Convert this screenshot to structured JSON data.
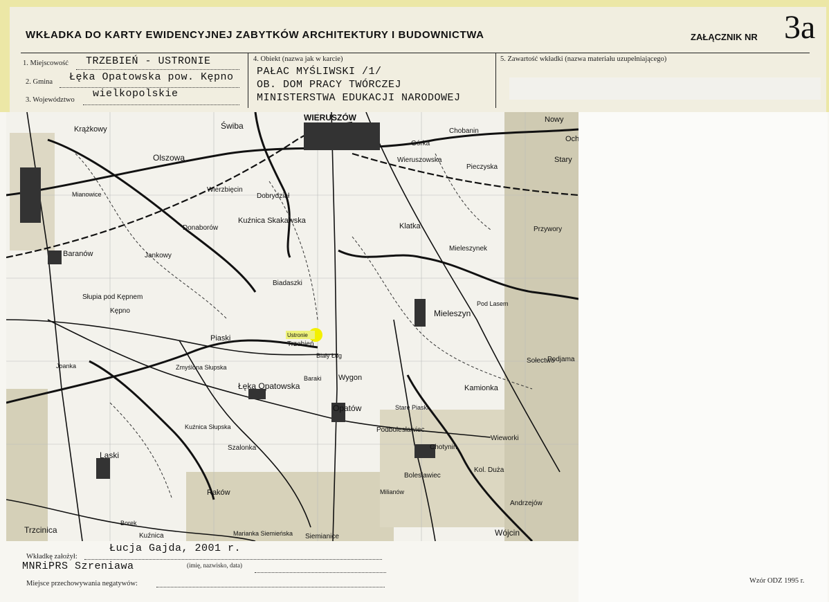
{
  "header": {
    "title": "WKŁADKA DO KARTY EWIDENCYJNEJ ZABYTKÓW ARCHITEKTURY I BUDOWNICTWA",
    "attachment_label": "ZAŁĄCZNIK NR",
    "attachment_number": "3a"
  },
  "fields": {
    "f1_label": "1. Miejscowość",
    "f1_value": "TRZEBIEŃ - USTRONIE",
    "f1_sub": "Łęka Opatowska  pow. Kępno",
    "f2_label": "2. Gmina",
    "f3_label": "3. Województwo",
    "f3_value": "wielkopolskie",
    "f4_label": "4. Obiekt (nazwa jak w karcie)",
    "f4_line1": "PAŁAC MYŚLIWSKI  /1/",
    "f4_line2": "OB. DOM PRACY TWÓRCZEJ",
    "f4_line3": "MINISTERSTWA EDUKACJI NARODOWEJ",
    "f5_label": "5. Zawartość wkładki (nazwa materiału uzupełniającego)"
  },
  "map": {
    "places": [
      "Krążkowy",
      "Świba",
      "WIERUSZÓW",
      "Chobanin",
      "Nowy",
      "Oche",
      "Olszowa",
      "Wieruszowska",
      "Górka",
      "Pieczyska",
      "Stary",
      "Mianowice",
      "Wierzbięcin",
      "Dobrydział",
      "Kuźnica Skakawska",
      "Klatka",
      "Przywory",
      "Donaborów",
      "Baranów",
      "Mieleszynek",
      "Jankowy",
      "Biadaszki",
      "Słupia pod Kępnem",
      "Mieleszyn",
      "Ustronie",
      "Trzebień",
      "Piaski",
      "Sołectwo",
      "Podjama",
      "Joanka",
      "Zmyślona Słupska",
      "Łęka Opatowska",
      "Wygon",
      "Opatów",
      "Kamionka",
      "Kuźnica Słupska",
      "Szalonka",
      "Podbolesławiec",
      "Chotynin",
      "Wieworki",
      "Laski",
      "Raków",
      "Kol. Duża",
      "Bolesławiec",
      "Andrzejów",
      "Trzcinica",
      "Borek",
      "Kuźnica",
      "Marianka Siemieńska",
      "Siemianice",
      "Wójcin",
      "Milianów",
      "Baraki",
      "Stare Piaski",
      "Pod Lasem",
      "Biały Ług",
      "Kępno"
    ],
    "highlight": "Ustronie"
  },
  "footer": {
    "founder_label": "Wkładkę założył:",
    "founder_value": "Łucja Gajda, 2001 r.",
    "founder_hint": "(imię, nazwisko, data)",
    "institution": "MNRiPRS Szreniawa",
    "negatives_label": "Miejsce przechowywania negatywów:",
    "form_version": "Wzór ODZ 1995 r."
  },
  "colors": {
    "band": "#ece7a6",
    "highlight": "#f3f000"
  }
}
